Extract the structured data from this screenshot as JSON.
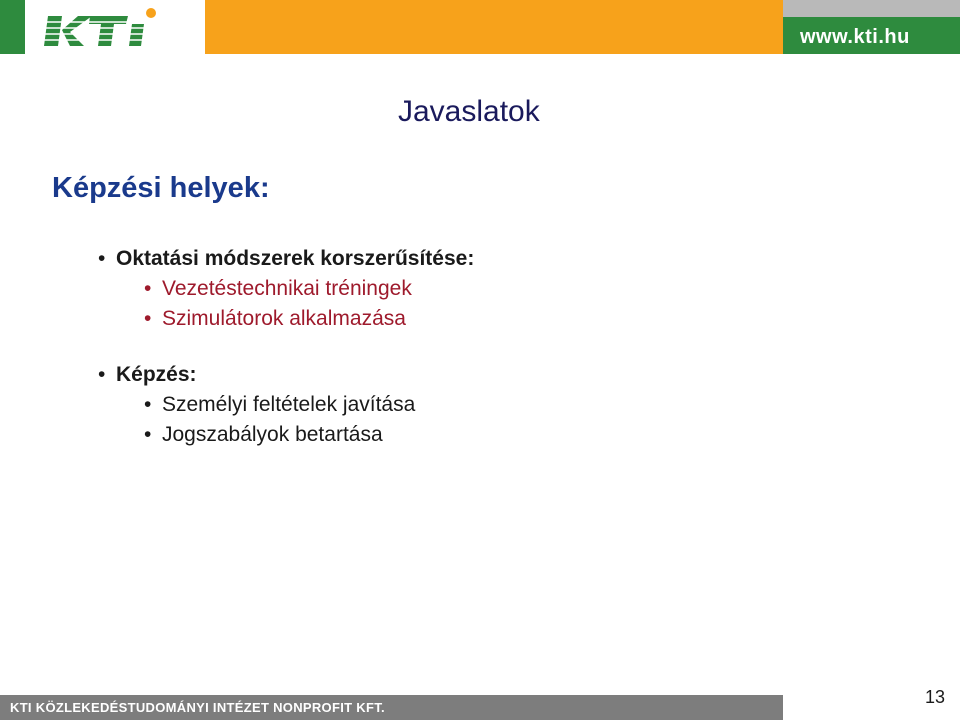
{
  "header": {
    "logo_text": "KTI",
    "url": "www.kti.hu"
  },
  "slide": {
    "title": "Javaslatok",
    "subheading": "Képzési helyek:",
    "sections": [
      {
        "label": "Oktatási módszerek korszerűsítése:",
        "items": [
          "Vezetéstechnikai tréningek",
          "Szimulátorok alkalmazása"
        ]
      },
      {
        "label": "Képzés:",
        "items": [
          "Személyi feltételek javítása",
          "Jogszabályok betartása"
        ]
      }
    ],
    "bullet_char": "•"
  },
  "footer": {
    "org_name": "KTI KÖZLEKEDÉSTUDOMÁNYI INTÉZET NONPROFIT KFT.",
    "page_number": "13"
  },
  "colors": {
    "green": "#2e8b3e",
    "orange": "#f7a21b",
    "footer_gray": "#7d7d7d",
    "title_navy": "#1a1a5c",
    "subheading_blue": "#1a3a8c",
    "subitem_red": "#9e1a2c"
  }
}
